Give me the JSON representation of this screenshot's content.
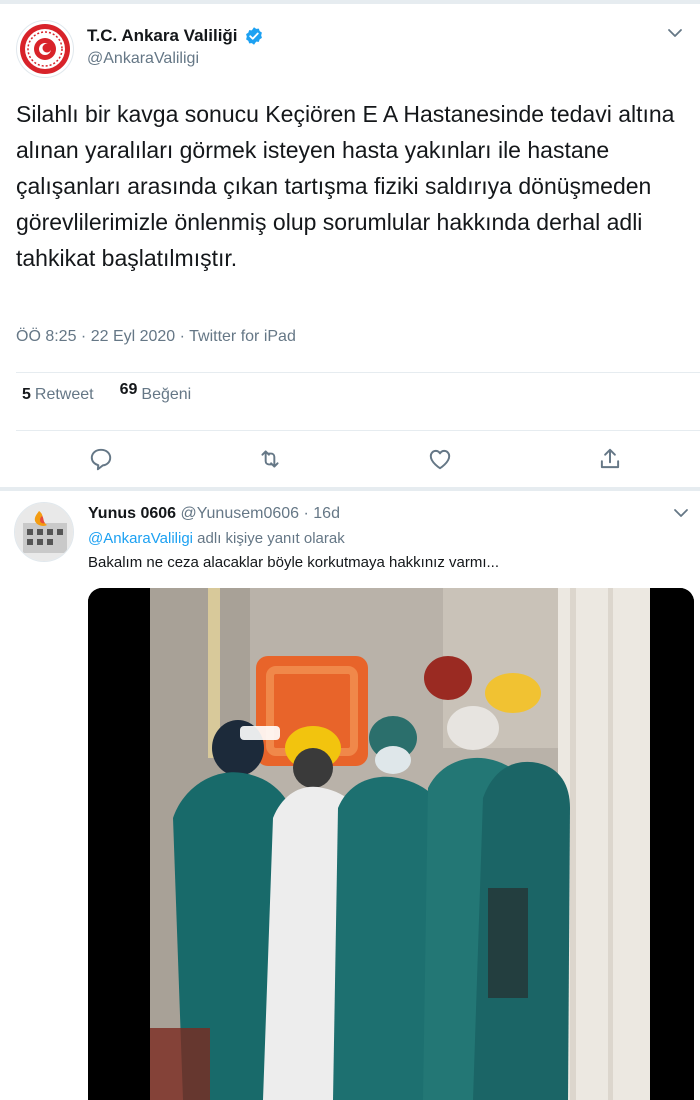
{
  "main_tweet": {
    "author_name": "T.C. Ankara Valiliği",
    "author_handle": "@AnkaraValiligi",
    "text": "Silahlı bir kavga sonucu Keçiören E A Hastanesinde tedavi altına alınan yaralıları görmek isteyen hasta yakınları ile hastane çalışanları arasında çıkan tartışma fiziki saldırıya dönüşmeden görevlilerimizle önlenmiş olup sorumlular hakkında derhal adli tahkikat başlatılmıştır.",
    "meta": "ÖÖ 8:25 · 22 Eyl 2020 · Twitter for iPad",
    "retweet_count": "5",
    "retweet_label": "Retweet",
    "like_count": "69",
    "like_label": "Beğeni"
  },
  "actions": [
    {
      "icon": "reply-icon"
    },
    {
      "icon": "retweet-icon"
    },
    {
      "icon": "like-icon"
    },
    {
      "icon": "share-icon"
    }
  ],
  "reply": {
    "author_name": "Yunus 0606",
    "author_handle": "@Yunusem0606",
    "time": "16d",
    "reply_mention": "@AnkaraValiligi",
    "reply_suffix": "adlı kişiye yanıt olarak",
    "text": "Bakalım ne ceza alacaklar böyle korkutmaya hakkınız varmı..."
  },
  "colors": {
    "accent": "#1da1f2",
    "text": "#14171a",
    "secondary": "#657786",
    "border": "#e6ecf0",
    "logo_red": "#d8232a"
  }
}
